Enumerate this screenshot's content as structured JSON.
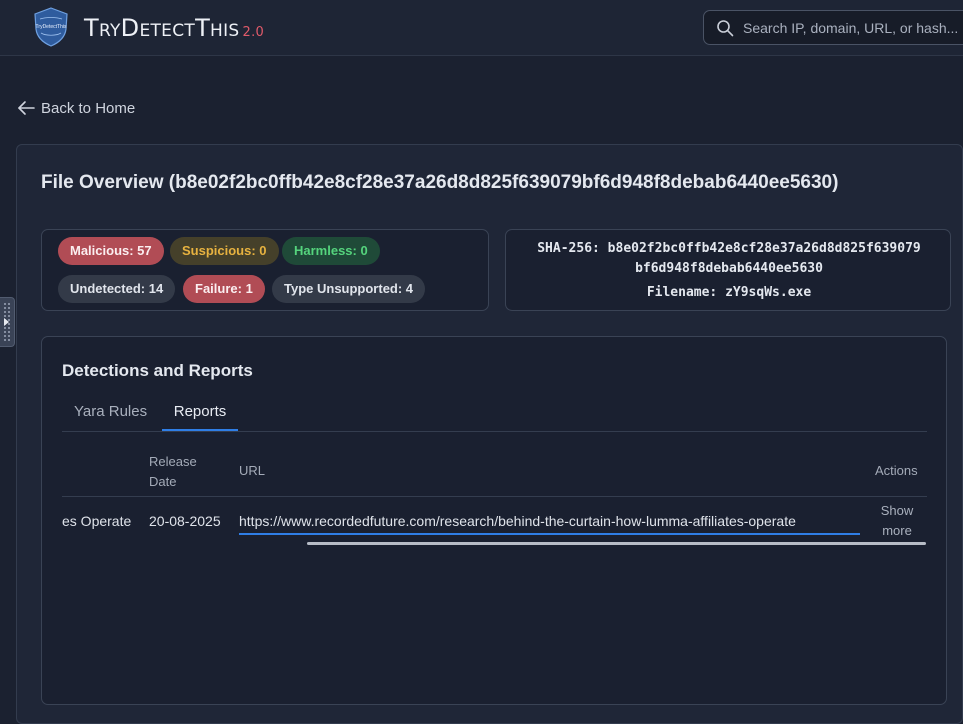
{
  "header": {
    "brand": "TryDetectThis",
    "version": "2.0",
    "logo_text": "TryDetectThis",
    "search_placeholder": "Search IP, domain, URL, or hash..."
  },
  "nav": {
    "back_label": "Back to Home"
  },
  "overview": {
    "title": "File Overview (b8e02f2bc0ffb42e8cf28e37a26d8d825f639079bf6d948f8debab6440ee5630)",
    "stats": {
      "malicious": "Malicious: 57",
      "suspicious": "Suspicious: 0",
      "harmless": "Harmless: 0",
      "undetected": "Undetected: 14",
      "failure": "Failure: 1",
      "type_unsupported": "Type Unsupported: 4"
    },
    "hash_line1": "SHA-256: b8e02f2bc0ffb42e8cf28e37a26d8d825f639079",
    "hash_line2": "bf6d948f8debab6440ee5630",
    "filename_line": "Filename: zY9sqWs.exe"
  },
  "detections": {
    "title": "Detections and Reports",
    "tabs": [
      {
        "label": "Yara Rules",
        "active": false
      },
      {
        "label": "Reports",
        "active": true
      }
    ],
    "columns": {
      "release_date_1": "Release",
      "release_date_2": "Date",
      "url": "URL",
      "actions": "Actions"
    },
    "rows": [
      {
        "name": "es Operate",
        "release_date": "20-08-2025",
        "url": "https://www.recordedfuture.com/research/behind-the-curtain-how-lumma-affiliates-operate",
        "action_1": "Show",
        "action_2": "more"
      }
    ]
  },
  "colors": {
    "accent": "#2f7ee6",
    "malicious": "#b14c55",
    "suspicious": "#e7b240",
    "harmless": "#55d47d",
    "brand_version": "#e05a6a"
  }
}
